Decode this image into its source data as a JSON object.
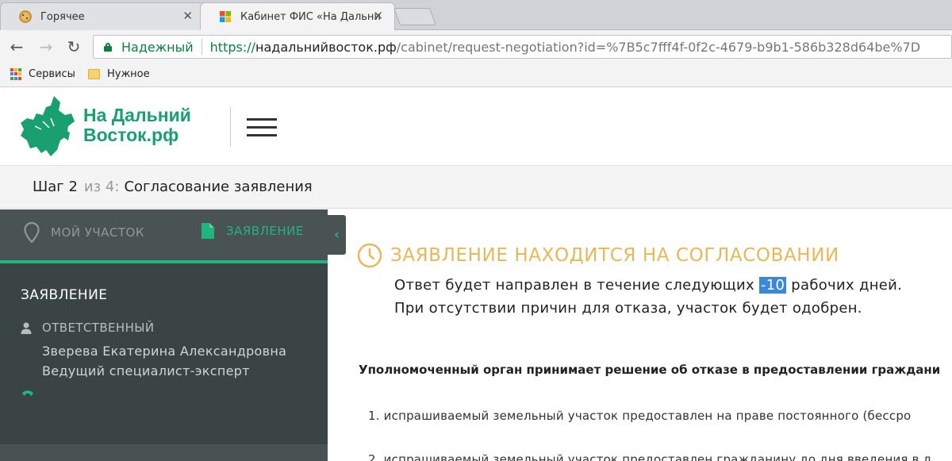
{
  "browser": {
    "tabs": [
      {
        "title": "Горячее",
        "active": false
      },
      {
        "title": "Кабинет ФИС «На Дальни",
        "active": true
      }
    ],
    "address": {
      "secure_label": "Надежный",
      "scheme": "https://",
      "host": "надальнийвосток.рф",
      "path": "/cabinet/request-negotiation?id=%7B5c7fff4f-0f2c-4679-b9b1-586b328d64be%7D"
    },
    "bookmarks": [
      {
        "label": "Сервисы",
        "icon": "apps-icon"
      },
      {
        "label": "Нужное",
        "icon": "folder-icon"
      }
    ]
  },
  "site": {
    "logo_line1": "На Дальний",
    "logo_line2": "Восток.рф",
    "brand_color": "#1aa070"
  },
  "step": {
    "prefix": "Шаг 2",
    "of": "из 4:",
    "title": "Согласование заявления"
  },
  "sidebar": {
    "tabs": [
      {
        "label": "МОЙ УЧАСТОК",
        "icon": "map-pin-icon",
        "active": false
      },
      {
        "label": "ЗАЯВЛЕНИЕ",
        "icon": "document-icon",
        "active": true
      }
    ],
    "collapse_glyph": "‹",
    "heading": "ЗАЯВЛЕНИЕ",
    "responsible_label": "ОТВЕТСТВЕННЫЙ",
    "responsible_name": "Зверева Екатерина Александровна",
    "responsible_role": "Ведущий специалист-эксперт"
  },
  "main": {
    "status_title": "ЗАЯВЛЕНИЕ НАХОДИТСЯ НА СОГЛАСОВАНИИ",
    "message_part1": "Ответ будет направлен в течение следующих ",
    "days_value": "-10",
    "message_part2": " рабочих дней.",
    "message_line2": "При отсутствии причин для отказа, участок будет одобрен.",
    "decision_text": "Уполномоченный орган принимает решение об отказе в предоставлении граждани",
    "list": [
      "1.  испрашиваемый земельный участок предоставлен на праве постоянного (бессро",
      "2.  испрашиваемый земельный участок предоставлен гражданину до дня введения в д"
    ],
    "accent_color": "#e6b85a"
  }
}
